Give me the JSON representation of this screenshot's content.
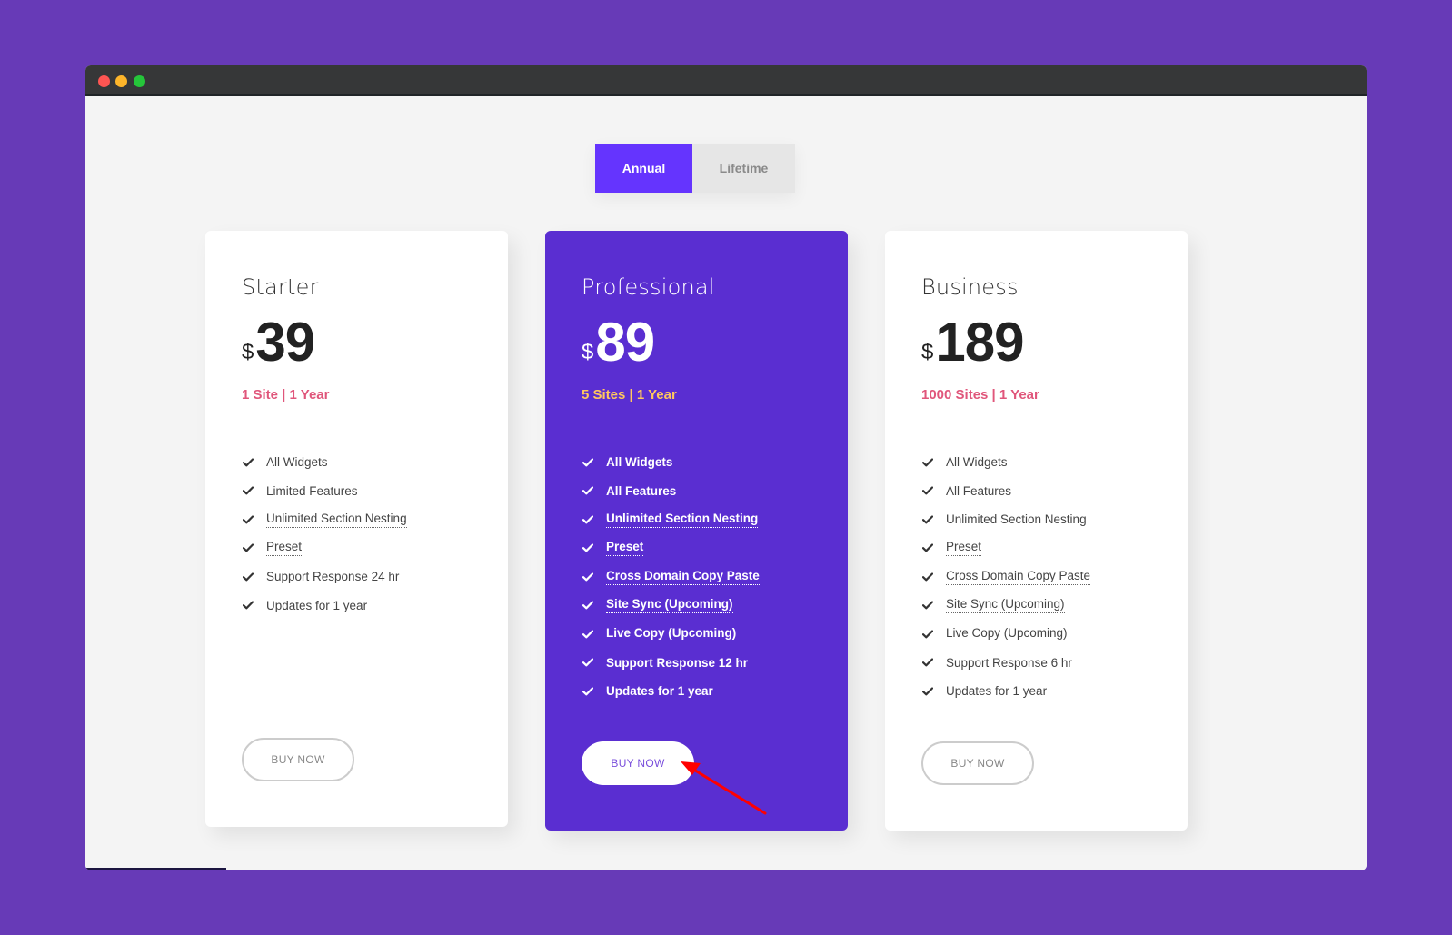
{
  "window": {
    "controls": [
      "close",
      "minimize",
      "maximize"
    ]
  },
  "toggle": {
    "options": [
      {
        "label": "Annual",
        "active": true
      },
      {
        "label": "Lifetime",
        "active": false
      }
    ]
  },
  "plans": [
    {
      "name": "Starter",
      "currency": "$",
      "price": "39",
      "sites": "1 Site | 1 Year",
      "features": [
        {
          "text": "All Widgets",
          "tooltip": false
        },
        {
          "text": "Limited Features",
          "tooltip": false
        },
        {
          "text": "Unlimited Section Nesting",
          "tooltip": true
        },
        {
          "text": "Preset",
          "tooltip": true
        },
        {
          "text": "Support Response 24 hr",
          "tooltip": false
        },
        {
          "text": "Updates for 1 year",
          "tooltip": false
        }
      ],
      "button": "BUY NOW",
      "highlighted": false
    },
    {
      "name": "Professional",
      "currency": "$",
      "price": "89",
      "sites": "5 Sites | 1 Year",
      "features": [
        {
          "text": "All Widgets",
          "tooltip": false
        },
        {
          "text": "All Features",
          "tooltip": false
        },
        {
          "text": "Unlimited Section Nesting",
          "tooltip": true
        },
        {
          "text": "Preset",
          "tooltip": true
        },
        {
          "text": "Cross Domain Copy Paste",
          "tooltip": true
        },
        {
          "text": "Site Sync (Upcoming)",
          "tooltip": true
        },
        {
          "text": "Live Copy (Upcoming)",
          "tooltip": true
        },
        {
          "text": "Support Response 12 hr",
          "tooltip": false
        },
        {
          "text": "Updates for 1 year",
          "tooltip": false
        }
      ],
      "button": "BUY NOW",
      "highlighted": true
    },
    {
      "name": "Business",
      "currency": "$",
      "price": "189",
      "sites": "1000 Sites | 1 Year",
      "features": [
        {
          "text": "All Widgets",
          "tooltip": false
        },
        {
          "text": "All Features",
          "tooltip": false
        },
        {
          "text": "Unlimited Section Nesting",
          "tooltip": false
        },
        {
          "text": "Preset",
          "tooltip": true
        },
        {
          "text": "Cross Domain Copy Paste",
          "tooltip": true
        },
        {
          "text": "Site Sync (Upcoming)",
          "tooltip": true
        },
        {
          "text": "Live Copy (Upcoming)",
          "tooltip": true
        },
        {
          "text": "Support Response 6 hr",
          "tooltip": false
        },
        {
          "text": "Updates for 1 year",
          "tooltip": false
        }
      ],
      "button": "BUY NOW",
      "highlighted": false
    }
  ],
  "colors": {
    "background": "#673ab7",
    "accent": "#6534fe",
    "highlight_card": "#5a2ed1",
    "sites_text": "#e0567b",
    "sites_text_highlight": "#ffc75e",
    "annotation_arrow": "#ff0000"
  },
  "annotation": {
    "type": "arrow",
    "points_to": "professional-buy-now-button"
  }
}
